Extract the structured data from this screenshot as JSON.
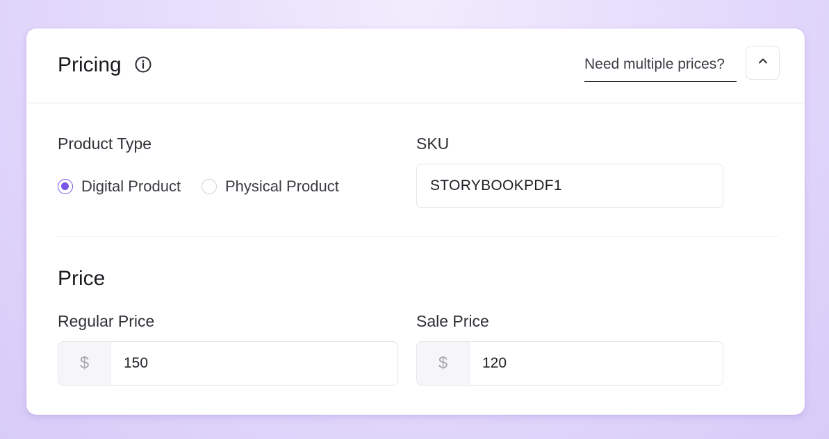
{
  "header": {
    "title": "Pricing",
    "multiple_prices_link": "Need multiple prices?"
  },
  "product_type": {
    "label": "Product Type",
    "options": [
      {
        "label": "Digital Product",
        "selected": true
      },
      {
        "label": "Physical Product",
        "selected": false
      }
    ]
  },
  "sku": {
    "label": "SKU",
    "value": "STORYBOOKPDF1"
  },
  "price": {
    "section_title": "Price",
    "regular": {
      "label": "Regular Price",
      "currency": "$",
      "value": "150"
    },
    "sale": {
      "label": "Sale Price",
      "currency": "$",
      "value": "120"
    }
  },
  "colors": {
    "accent": "#7a55e6",
    "background": "#e3d9fb"
  },
  "icons": [
    "info-icon",
    "chevron-up-icon"
  ]
}
